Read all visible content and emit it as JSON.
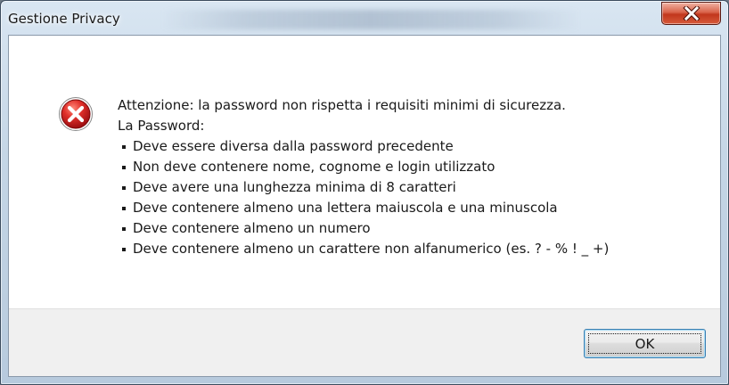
{
  "window": {
    "title": "Gestione Privacy"
  },
  "titlebar": {
    "close_icon": "close-x-icon"
  },
  "dialog": {
    "icon": "error-icon",
    "heading": "Attenzione: la password non rispetta i requisiti minimi di sicurezza.",
    "subheading": "La Password:",
    "requirements": [
      "Deve essere diversa dalla password precedente",
      "Non deve contenere nome, cognome e login utilizzato",
      "Deve avere una lunghezza minima di 8 caratteri",
      "Deve contenere almeno una lettera maiuscola e una minuscola",
      "Deve contenere almeno un numero",
      "Deve contenere almeno un carattere non alfanumerico (es. ? - % ! _ +)"
    ]
  },
  "buttons": {
    "ok_label": "OK"
  },
  "colors": {
    "error_red": "#c9171c",
    "close_red": "#c1371d",
    "focus_blue": "#3c7fb1"
  }
}
